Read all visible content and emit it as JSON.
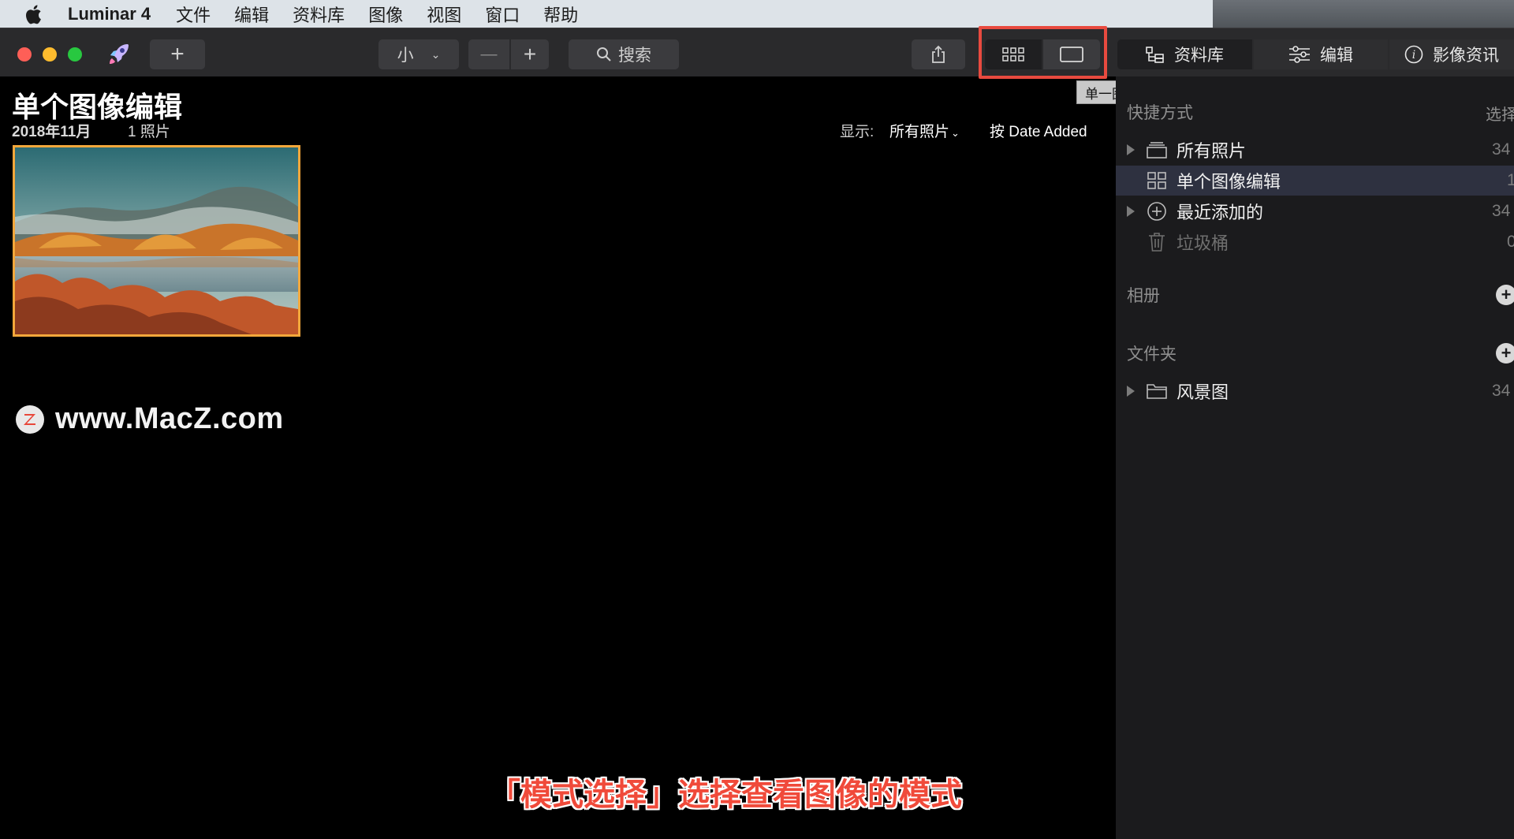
{
  "menubar": {
    "app_name": "Luminar 4",
    "items": [
      "文件",
      "编辑",
      "资料库",
      "图像",
      "视图",
      "窗口",
      "帮助"
    ]
  },
  "toolbar": {
    "size_select": "小",
    "zoom_out": "—",
    "zoom_in": "+",
    "add": "+",
    "search_label": "搜索",
    "tooltip": "单一图片模式"
  },
  "panel_tabs": {
    "library": "资料库",
    "edit": "编辑",
    "info": "影像资讯"
  },
  "main": {
    "title": "单个图像编辑",
    "date": "2018年11月",
    "count": "1 照片",
    "show_label": "显示:",
    "show_value": "所有照片",
    "sort_label": "按 Date Added"
  },
  "sidebar": {
    "shortcuts_title": "快捷方式",
    "shortcuts_right": "选择",
    "shortcuts": [
      {
        "label": "所有照片",
        "count": "34"
      },
      {
        "label": "单个图像编辑",
        "count": "1"
      },
      {
        "label": "最近添加的",
        "count": "34"
      },
      {
        "label": "垃圾桶",
        "count": "0"
      }
    ],
    "albums_title": "相册",
    "folders_title": "文件夹",
    "folders": [
      {
        "label": "风景图",
        "count": "34"
      }
    ]
  },
  "watermark": "www.MacZ.com",
  "caption": "「模式选择」选择查看图像的模式",
  "colors": {
    "highlight_box": "#e84a3f",
    "selected_thumb_border": "#f3a73b",
    "caption": "#f04a3a"
  }
}
